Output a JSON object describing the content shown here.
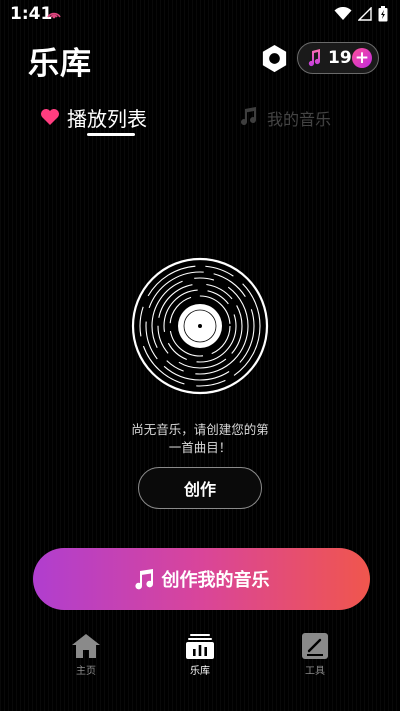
{
  "status_bar": {
    "time": "1:41"
  },
  "header": {
    "title": "乐库",
    "credits": "19",
    "add_symbol": "+"
  },
  "tabs": [
    {
      "label": "播放列表",
      "active": true
    },
    {
      "label": "我的音乐",
      "active": false
    }
  ],
  "empty_state": {
    "message_line1": "尚无音乐，请创建您的第",
    "message_line2": "一首曲目！",
    "create_label": "创作"
  },
  "cta": {
    "label": "创作我的音乐"
  },
  "bottom_nav": [
    {
      "label": "主页",
      "icon": "home-icon",
      "active": false
    },
    {
      "label": "乐库",
      "icon": "library-icon",
      "active": true
    },
    {
      "label": "工具",
      "icon": "tools-icon",
      "active": false
    }
  ],
  "colors": {
    "accent_pink": "#ff3d7f",
    "gradient_start": "#b03ecf",
    "gradient_end": "#f0564d",
    "background": "#000000"
  }
}
